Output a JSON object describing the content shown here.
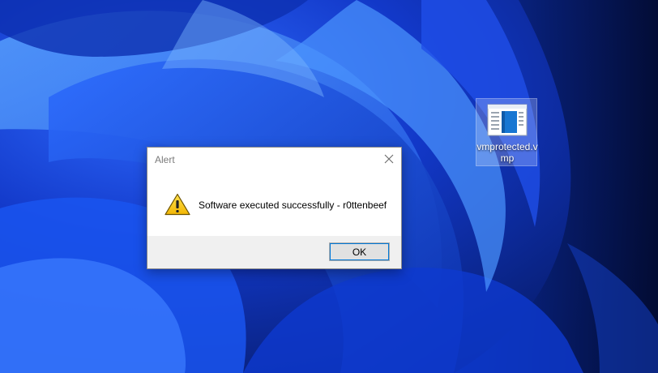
{
  "desktop": {
    "wallpaper": "windows-11-bloom",
    "colors": {
      "base": "#0a2a8c",
      "highlight": "#3f8cff",
      "dark": "#020a2e"
    },
    "icons": [
      {
        "label": "vmprotected.vmp",
        "icon": "file-icon"
      }
    ]
  },
  "dialog": {
    "title": "Alert",
    "message": "Software executed successfully - r0ttenbeef",
    "icon": "warning-icon",
    "ok_label": "OK",
    "close_icon": "close-icon"
  }
}
